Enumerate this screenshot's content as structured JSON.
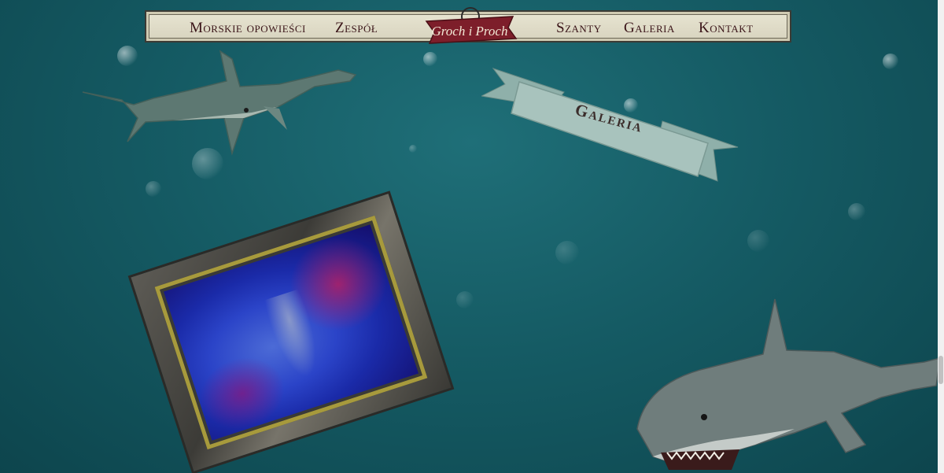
{
  "nav": {
    "left_items": [
      {
        "label": "Morskie opowieści"
      },
      {
        "label": "Zespół"
      }
    ],
    "right_items": [
      {
        "label": "Szanty"
      },
      {
        "label": "Galeria"
      },
      {
        "label": "Kontakt"
      }
    ],
    "logo": {
      "line1": "Groch",
      "line2": "i",
      "line3": "Proch"
    }
  },
  "banner": {
    "label": "Galeria"
  },
  "colors": {
    "water": "#155b64",
    "nav_bg": "#e3dfca",
    "nav_text": "#3a1418",
    "logo_red": "#7d1e2a",
    "banner_bg": "#a8c3bd",
    "frame_gold": "#a79a3c"
  }
}
